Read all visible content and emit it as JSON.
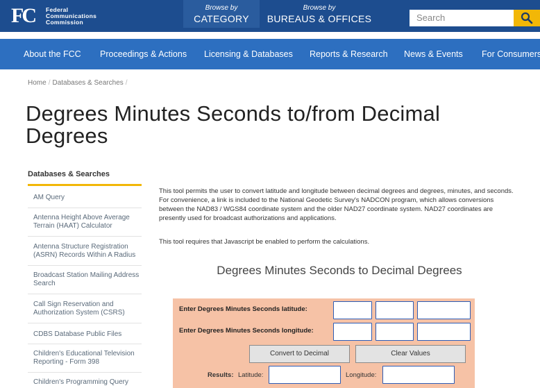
{
  "header": {
    "logo_mark": "FC",
    "logo_lines": [
      "Federal",
      "Communications",
      "Commission"
    ],
    "browse_category": {
      "by": "Browse by",
      "label": "CATEGORY"
    },
    "browse_bureaus": {
      "by": "Browse by",
      "label": "BUREAUS & OFFICES"
    },
    "search_placeholder": "Search"
  },
  "nav": [
    "About the FCC",
    "Proceedings & Actions",
    "Licensing & Databases",
    "Reports & Research",
    "News & Events",
    "For Consumers"
  ],
  "breadcrumb": [
    "Home",
    "Databases & Searches"
  ],
  "page_title": "Degrees Minutes Seconds to/from Decimal Degrees",
  "sidebar": {
    "heading": "Databases & Searches",
    "items": [
      "AM Query",
      "Antenna Height Above Average Terrain (HAAT) Calculator",
      "Antenna Structure Registration (ASRN) Records Within A Radius",
      "Broadcast Station Mailing Address Search",
      "Call Sign Reservation and Authorization System (CSRS)",
      "CDBS Database Public Files",
      "Children's Educational Television Reporting - Form 398",
      "Children's Programming Query"
    ]
  },
  "content": {
    "intro": "This tool permits the user to convert latitude and longitude between decimal degrees and degrees, minutes, and seconds.  For convenience, a link is included to the National Geodetic Survey's NADCON program, which allows conversions between the NAD83 / WGS84 coordinate system and the older NAD27 coordinate system.  NAD27 coordinates are presently used for broadcast authorizations and applications.",
    "js_note": "This tool requires that Javascript be enabled to perform the calculations.",
    "section_title": "Degrees Minutes Seconds to Decimal Degrees"
  },
  "form": {
    "lat_label": "Enter Degrees Minutes Seconds latitude:",
    "lon_label": "Enter Degrees Minutes Seconds longitude:",
    "convert_button": "Convert to Decimal",
    "clear_button": "Clear Values",
    "results_label": "Results:",
    "latitude_label": "Latitude:",
    "longitude_label": "Longitude:"
  },
  "colors": {
    "header_bg": "#1d4d8f",
    "nav_bg": "#2d6fc0",
    "accent": "#f2b707",
    "form_bg": "#f6c2a6"
  },
  "icons": {
    "search_button": "magnifier-icon"
  }
}
